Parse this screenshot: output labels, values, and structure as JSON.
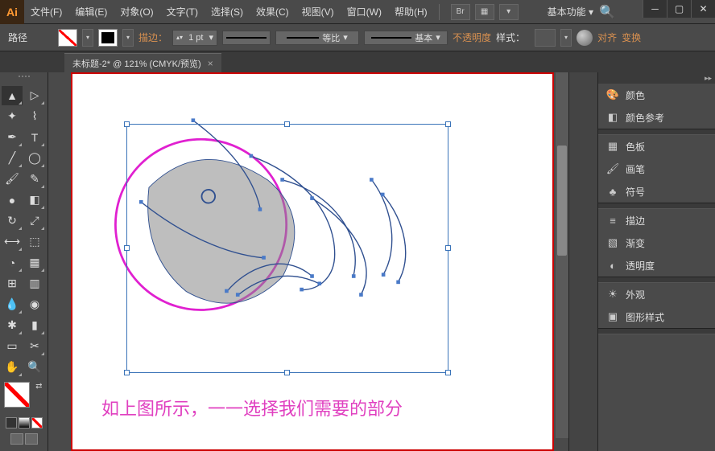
{
  "app": {
    "icon_text": "Ai"
  },
  "menu": {
    "items": [
      {
        "label": "文件(F)"
      },
      {
        "label": "编辑(E)"
      },
      {
        "label": "对象(O)"
      },
      {
        "label": "文字(T)"
      },
      {
        "label": "选择(S)"
      },
      {
        "label": "效果(C)"
      },
      {
        "label": "视图(V)"
      },
      {
        "label": "窗口(W)"
      },
      {
        "label": "帮助(H)"
      }
    ],
    "bridge_label": "Br",
    "workspace": "基本功能"
  },
  "controlbar": {
    "selection_label": "路径",
    "stroke_label": "描边：",
    "stroke_value": "1 pt",
    "profile_label": "等比",
    "brush_label": "基本",
    "opacity_label": "不透明度",
    "style_label": "样式：",
    "align_label": "对齐",
    "transform_label": "变换"
  },
  "document": {
    "tab_label": "未标题-2* @ 121% (CMYK/预览)"
  },
  "canvas": {
    "caption": "如上图所示，一一选择我们需要的部分"
  },
  "panels": {
    "group1": [
      {
        "label": "颜色",
        "icon": "palette"
      },
      {
        "label": "颜色参考",
        "icon": "guide"
      }
    ],
    "group2": [
      {
        "label": "色板",
        "icon": "swatches"
      },
      {
        "label": "画笔",
        "icon": "brush"
      },
      {
        "label": "符号",
        "icon": "symbol"
      }
    ],
    "group3": [
      {
        "label": "描边",
        "icon": "stroke"
      },
      {
        "label": "渐变",
        "icon": "gradient"
      },
      {
        "label": "透明度",
        "icon": "transparency"
      }
    ],
    "group4": [
      {
        "label": "外观",
        "icon": "appearance"
      },
      {
        "label": "图形样式",
        "icon": "graphic-styles"
      }
    ]
  }
}
